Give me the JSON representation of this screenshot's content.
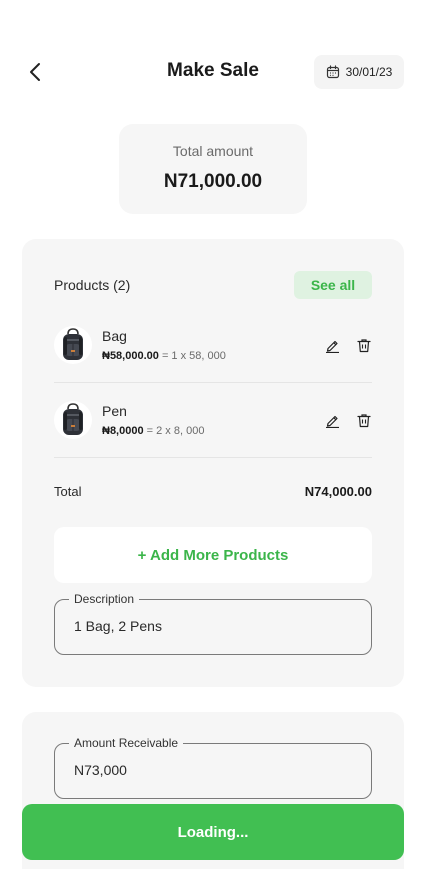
{
  "header": {
    "title": "Make Sale",
    "date": "30/01/23"
  },
  "summary": {
    "label": "Total amount",
    "value": "N71,000.00"
  },
  "products": {
    "title": "Products (2)",
    "see_all_label": "See all",
    "items": [
      {
        "name": "Bag",
        "price": "₦58,000.00",
        "calc": " = 1 x 58, 000"
      },
      {
        "name": "Pen",
        "price": "₦8,0000",
        "calc": " = 2 x 8, 000"
      }
    ],
    "total_label": "Total",
    "total_value": "N74,000.00",
    "add_more_label": "+ Add More Products",
    "description": {
      "label": "Description",
      "value": "1 Bag, 2 Pens"
    }
  },
  "amount": {
    "label": "Amount Receivable",
    "value": "N73,000"
  },
  "submit": {
    "label": "Loading..."
  },
  "colors": {
    "accent": "#41bf52",
    "accent_soft": "#dff2e1",
    "card_bg": "#f6f6f6"
  }
}
